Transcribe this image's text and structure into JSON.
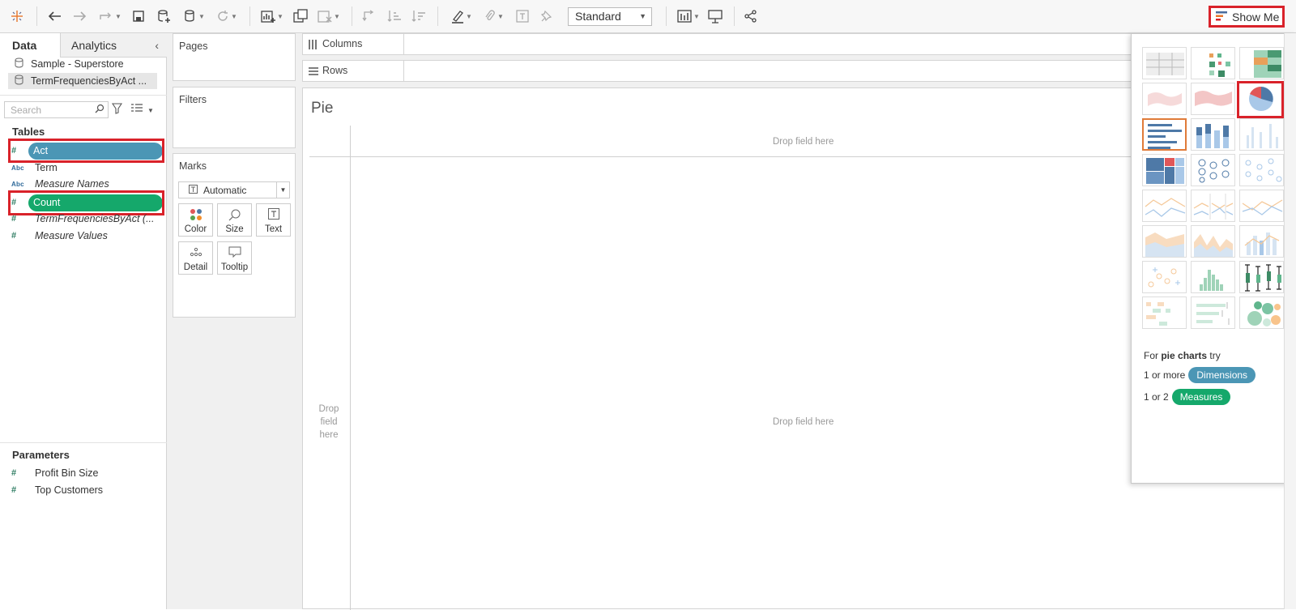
{
  "toolbar": {
    "mark_type_select": "Standard",
    "show_me_label": "Show Me"
  },
  "data_panel": {
    "tabs": [
      "Data",
      "Analytics"
    ],
    "datasources": [
      "Sample - Superstore",
      "TermFrequenciesByAct ..."
    ],
    "search_placeholder": "Search",
    "tables_header": "Tables",
    "fields": [
      {
        "type": "#",
        "name": "Act",
        "style": "dimension-pill"
      },
      {
        "type": "Abc",
        "name": "Term",
        "style": "plain"
      },
      {
        "type": "Abc",
        "name": "Measure Names",
        "style": "italic"
      },
      {
        "type": "#",
        "name": "Count",
        "style": "measure-pill"
      },
      {
        "type": "#",
        "name": "TermFrequenciesByAct (...",
        "style": "italic"
      },
      {
        "type": "#",
        "name": "Measure Values",
        "style": "italic"
      }
    ],
    "parameters_header": "Parameters",
    "parameters": [
      "Profit Bin Size",
      "Top Customers"
    ]
  },
  "cards": {
    "pages": "Pages",
    "filters": "Filters",
    "marks": "Marks",
    "marks_type": "Automatic",
    "mark_buttons": [
      "Color",
      "Size",
      "Text",
      "Detail",
      "Tooltip"
    ]
  },
  "shelves": {
    "columns": "Columns",
    "rows": "Rows"
  },
  "view": {
    "sheet_title": "Pie",
    "drop_top": "Drop field here",
    "drop_left": "Drop field here",
    "drop_center": "Drop field here"
  },
  "show_me": {
    "hint_prefix": "For ",
    "hint_bold": "pie charts",
    "hint_suffix": " try",
    "req1_prefix": "1 or more",
    "req1_pill": "Dimensions",
    "req2_prefix": "1 or 2",
    "req2_pill": "Measures"
  },
  "colors": {
    "dimension": "#4b96b5",
    "measure": "#15a86b",
    "highlight": "#d9222a",
    "active_thumb": "#e07b39"
  }
}
